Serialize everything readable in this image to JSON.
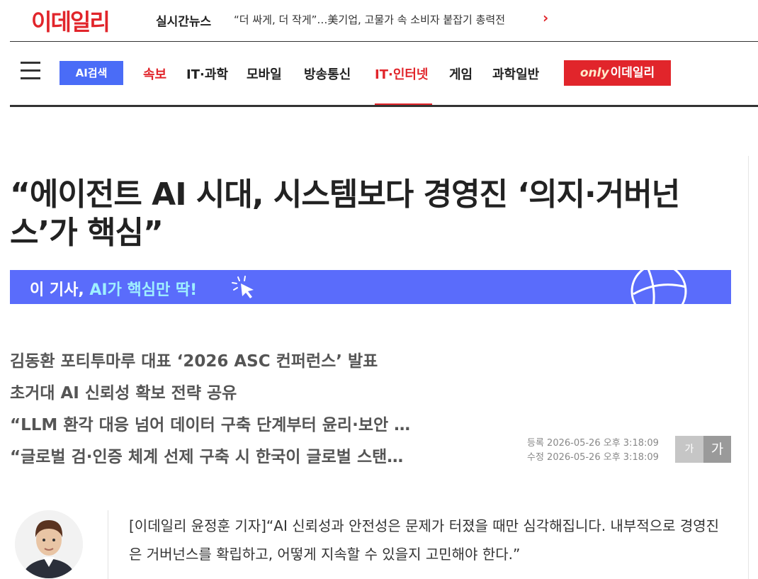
{
  "brand": {
    "logo": "이데일리",
    "color": "#e1252b"
  },
  "ticker": {
    "label": "실시간뉴스",
    "headline": "“더 싸게, 더 작게”…美기업, 고물가 속 소비자 붙잡기 총력전",
    "arrow_icon": "chevron-right-icon"
  },
  "nav": {
    "menu_icon": "hamburger-icon",
    "ai_search": "AI검색",
    "items": [
      {
        "label": "속보"
      },
      {
        "label": "IT·과학"
      },
      {
        "label": "모바일"
      },
      {
        "label": "방송통신"
      },
      {
        "label": "IT·인터넷"
      },
      {
        "label": "게임"
      },
      {
        "label": "과학일반"
      }
    ],
    "active": "IT·인터넷",
    "only_badge": {
      "prefix": "only",
      "text": "이데일리"
    }
  },
  "article": {
    "headline": "“에이전트 AI 시대, 시스템보다 경영진 ‘의지·거버넌스’가 핵심”",
    "ai_banner": {
      "prefix": "이 기사, ",
      "highlight": "AI가 핵심만 딱!",
      "icons": [
        "click-cursor-icon",
        "globe-icon"
      ]
    },
    "subtitles": [
      "김동환 포티투마루 대표 ‘2026 ASC 컨퍼런스’ 발표",
      "초거대 AI 신뢰성 확보 전략 공유",
      "“LLM 환각 대응 넘어 데이터 구축 단계부터 윤리·보안 …",
      "“글로벌 검·인증 체계 선제 구축 시 한국이 글로벌 스탠…"
    ],
    "registered": "등록 2026-05-26 오후 3:18:09",
    "modified": "수정 2026-05-26 오후 3:18:09",
    "font_small": "가",
    "font_large": "가",
    "body": "[이데일리 윤정훈 기자]“AI 신뢰성과 안전성은 문제가 터졌을 때만 심각해집니다. 내부적으로 경영진은 거버넌스를 확립하고, 어떻게 지속할 수 있을지 고민해야 한다.”"
  }
}
